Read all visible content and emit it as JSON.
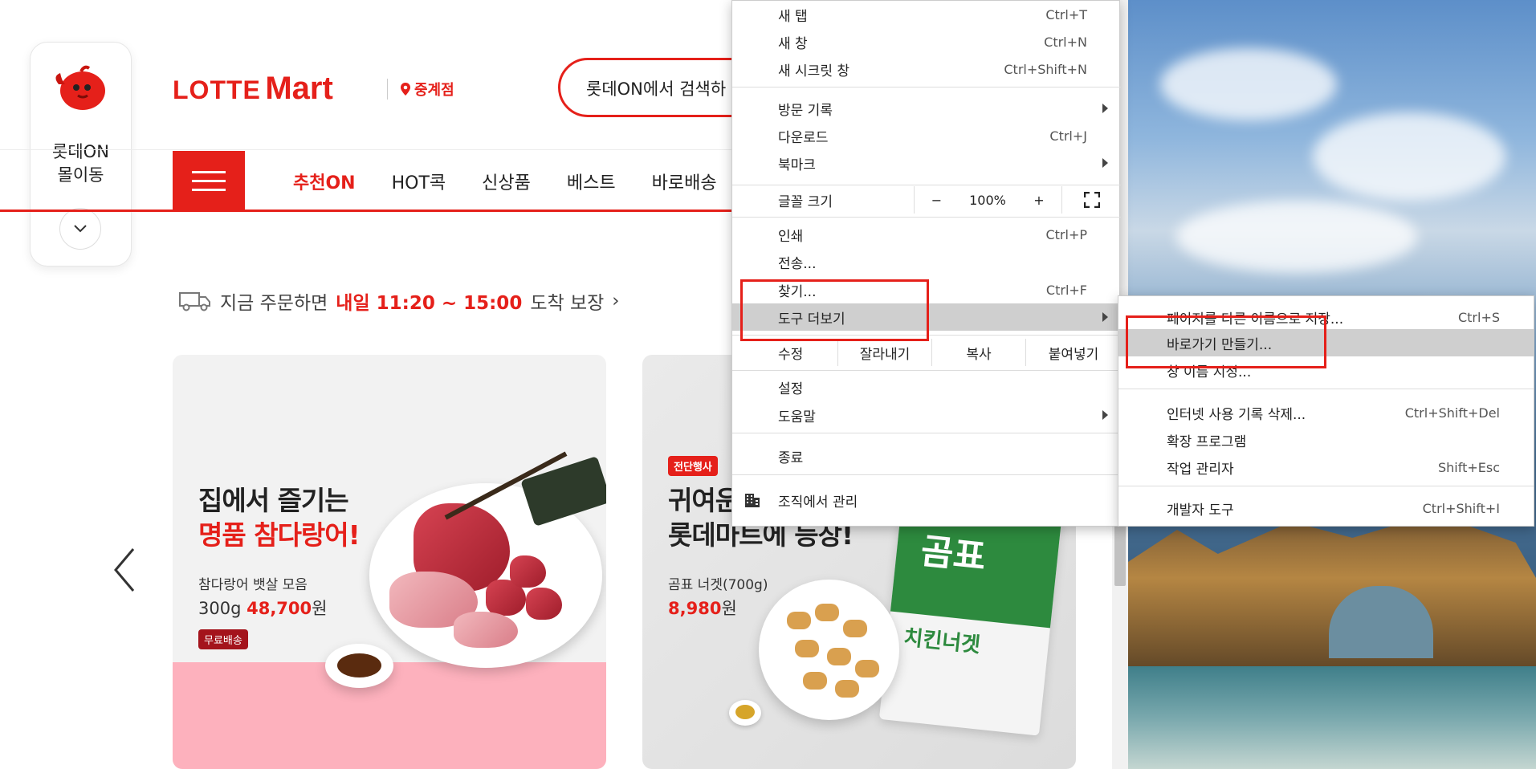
{
  "page": {
    "quick_panel": {
      "label_line1": "롯데ON",
      "label_line2": "몰이동"
    },
    "logo": {
      "part1": "LOTTE",
      "part2": "Mart"
    },
    "store_name": "중계점",
    "search_text": "롯데ON에서 검색하",
    "nav_items": [
      "추천ON",
      "HOT콕",
      "신상품",
      "베스트",
      "바로배송"
    ],
    "delivery": {
      "pre": "지금 주문하면",
      "highlight": "내일 11:20 ~ 15:00",
      "post": "도착 보장",
      "chevron": "›"
    },
    "banner_a": {
      "title_line1": "집에서 즐기는",
      "title_line2": "명품 참다랑어!",
      "subtitle": "참다랑어 뱃살 모음",
      "price_qty": "300g",
      "price_value": "48,700",
      "price_unit": "원",
      "badge": "무료배송"
    },
    "banner_b": {
      "badge": "전단행사",
      "title_line1": "귀여운",
      "title_line2": "롯데마트에 등장!",
      "subtitle": "곰표 너겟(700g)",
      "price_value": "8,980",
      "price_unit": "원",
      "bag_text": "곰표",
      "bag_sub": "치킨너겟"
    }
  },
  "context_menu": {
    "items": {
      "new_tab": {
        "label": "새 탭",
        "shortcut": "Ctrl+T"
      },
      "new_window": {
        "label": "새 창",
        "shortcut": "Ctrl+N"
      },
      "incognito": {
        "label": "새 시크릿 창",
        "shortcut": "Ctrl+Shift+N"
      },
      "history": {
        "label": "방문 기록"
      },
      "downloads": {
        "label": "다운로드",
        "shortcut": "Ctrl+J"
      },
      "bookmarks": {
        "label": "북마크"
      },
      "print": {
        "label": "인쇄",
        "shortcut": "Ctrl+P"
      },
      "cast": {
        "label": "전송..."
      },
      "find": {
        "label": "찾기...",
        "shortcut": "Ctrl+F"
      },
      "more_tools": {
        "label": "도구 더보기"
      },
      "settings": {
        "label": "설정"
      },
      "help": {
        "label": "도움말"
      },
      "exit": {
        "label": "종료"
      },
      "managed": {
        "label": "조직에서 관리"
      }
    },
    "zoom": {
      "label": "글꼴 크기",
      "minus": "−",
      "value": "100%",
      "plus": "+"
    },
    "edit": {
      "label": "수정",
      "cut": "잘라내기",
      "copy": "복사",
      "paste": "붙여넣기"
    }
  },
  "submenu": {
    "items": [
      {
        "label": "페이지를 다른 이름으로 저장...",
        "shortcut": "Ctrl+S"
      },
      {
        "label": "바로가기 만들기...",
        "shortcut": ""
      },
      {
        "label": "창 이름 지정...",
        "shortcut": ""
      },
      {
        "label": "인터넷 사용 기록 삭제...",
        "shortcut": "Ctrl+Shift+Del"
      },
      {
        "label": "확장 프로그램",
        "shortcut": ""
      },
      {
        "label": "작업 관리자",
        "shortcut": "Shift+Esc"
      },
      {
        "label": "개발자 도구",
        "shortcut": "Ctrl+Shift+I"
      }
    ]
  },
  "colors": {
    "brand_red": "#e5201a",
    "highlight_gray": "#cfcfcf",
    "annotation_red": "#e5201a"
  }
}
